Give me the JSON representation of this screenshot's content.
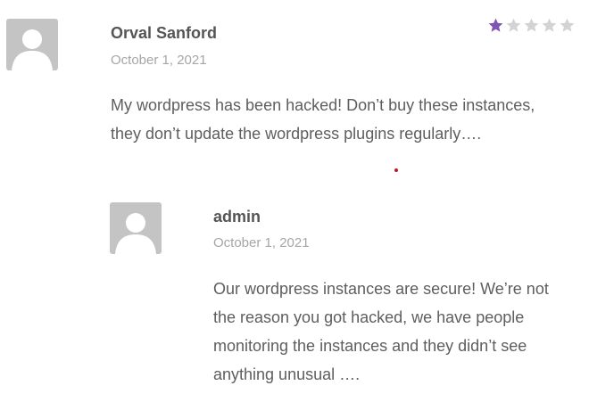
{
  "comments": [
    {
      "author": "Orval Sanford",
      "date": "October 1, 2021",
      "text": "My wordpress has been hacked! Don’t buy these instances, they don’t update the wordpress plugins regularly….",
      "rating": 1,
      "rating_max": 5
    }
  ],
  "reply": {
    "author": "admin",
    "date": "October 1, 2021",
    "text": "Our wordpress instances are secure! We’re not the reason you got hacked, we have people monitoring the instances and they didn’t see anything unusual …."
  },
  "icons": {
    "avatar": "default-user-avatar-icon",
    "star": "star-icon"
  },
  "colors": {
    "star_filled": "#7f54b3",
    "star_empty": "#d3d3d3",
    "avatar_bg": "#c4c4c4",
    "marker_dot": "#c0181b"
  }
}
